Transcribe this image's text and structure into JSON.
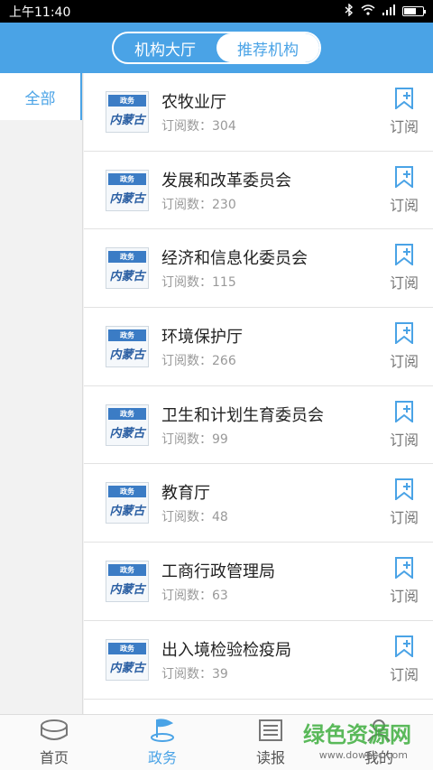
{
  "status": {
    "time": "上午11:40"
  },
  "header": {
    "tabs": [
      {
        "label": "机构大厅"
      },
      {
        "label": "推荐机构"
      }
    ]
  },
  "sidebar": {
    "items": [
      {
        "label": "全部"
      }
    ]
  },
  "logo": {
    "top_text": "政务",
    "script_text": "内蒙古"
  },
  "list": [
    {
      "title": "农牧业厅",
      "count": "订阅数：304",
      "subscribe": "订阅"
    },
    {
      "title": "发展和改革委员会",
      "count": "订阅数：230",
      "subscribe": "订阅"
    },
    {
      "title": "经济和信息化委员会",
      "count": "订阅数：115",
      "subscribe": "订阅"
    },
    {
      "title": "环境保护厅",
      "count": "订阅数：266",
      "subscribe": "订阅"
    },
    {
      "title": "卫生和计划生育委员会",
      "count": "订阅数：99",
      "subscribe": "订阅"
    },
    {
      "title": "教育厅",
      "count": "订阅数：48",
      "subscribe": "订阅"
    },
    {
      "title": "工商行政管理局",
      "count": "订阅数：63",
      "subscribe": "订阅"
    },
    {
      "title": "出入境检验检疫局",
      "count": "订阅数：39",
      "subscribe": "订阅"
    }
  ],
  "tabbar": {
    "items": [
      {
        "label": "首页"
      },
      {
        "label": "政务"
      },
      {
        "label": "读报"
      },
      {
        "label": "我的"
      }
    ]
  },
  "watermark": {
    "text": "绿色资源网",
    "url": "www.downcc.com"
  },
  "colors": {
    "accent": "#4aa3e6",
    "green": "#3fae3f"
  }
}
